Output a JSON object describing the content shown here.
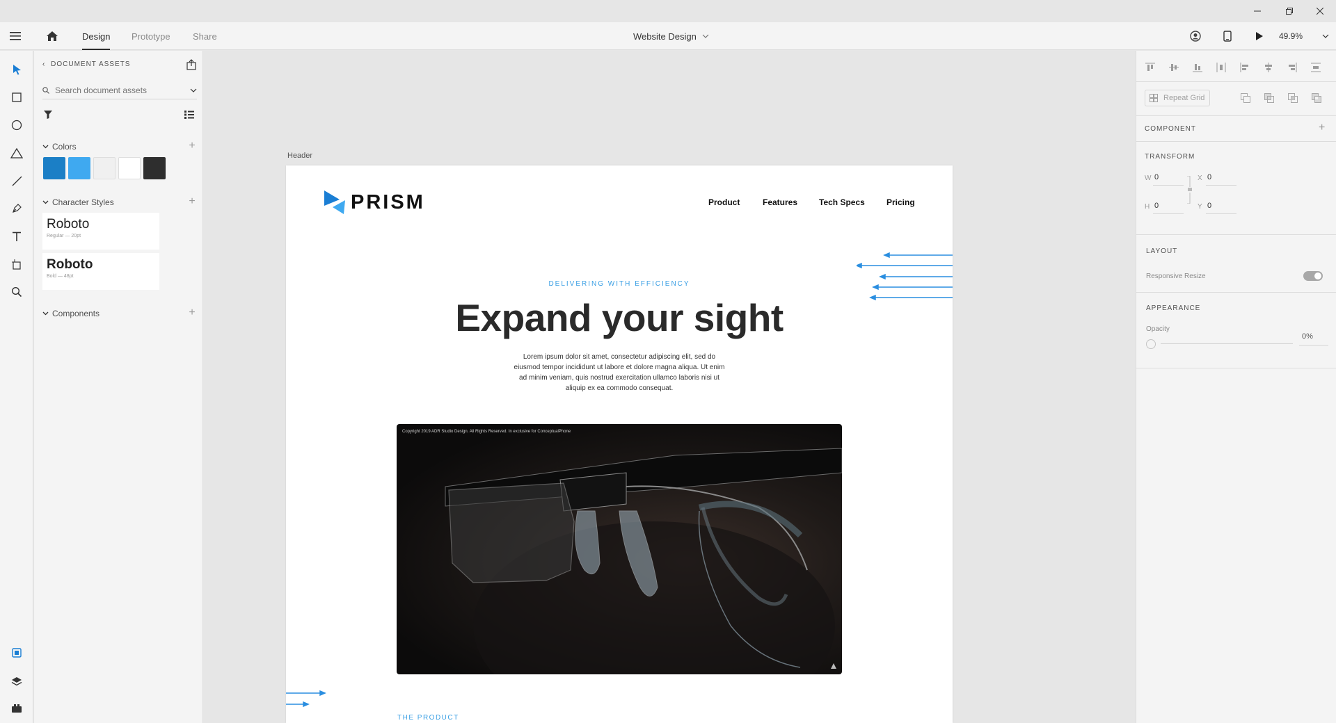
{
  "app": {
    "tabs": [
      {
        "label": "Design"
      },
      {
        "label": "Prototype"
      },
      {
        "label": "Share"
      }
    ],
    "doc_title": "Website Design",
    "zoom": "49.9%"
  },
  "assets": {
    "header": "DOCUMENT ASSETS",
    "search_placeholder": "Search document assets",
    "colors_label": "Colors",
    "colors": [
      "#1b7fc6",
      "#3fa9f0",
      "#f0f0f0",
      "#ffffff",
      "#2e2e2e"
    ],
    "character_styles_label": "Character Styles",
    "character_styles": [
      {
        "name": "Roboto",
        "meta": "Regular — 20pt"
      },
      {
        "name": "Roboto",
        "meta": "Bold — 48pt"
      }
    ],
    "components_label": "Components"
  },
  "canvas": {
    "artboard_label": "Header",
    "logo": "PRISM",
    "nav": [
      "Product",
      "Features",
      "Tech Specs",
      "Pricing"
    ],
    "eyebrow": "DELIVERING WITH EFFICIENCY",
    "hero_title": "Expand your sight",
    "hero_body": "Lorem ipsum dolor sit amet, consectetur adipiscing elit, sed do eiusmod tempor incididunt ut labore et dolore magna aliqua. Ut enim ad minim veniam, quis nostrud exercitation ullamco laboris nisi ut aliquip ex ea commodo consequat.",
    "image_copyright": "Copyright 2019 ADR Studio Design. All Rights Reserved. In exclusive for ConceptualPhone",
    "section_eyebrow": "THE PRODUCT",
    "accent_color": "#3a9fe4"
  },
  "props": {
    "repeat_grid": "Repeat Grid",
    "component": "COMPONENT",
    "transform": "TRANSFORM",
    "w_label": "W",
    "w_value": "0",
    "x_label": "X",
    "x_value": "0",
    "h_label": "H",
    "h_value": "0",
    "y_label": "Y",
    "y_value": "0",
    "layout": "LAYOUT",
    "responsive_resize": "Responsive Resize",
    "responsive_resize_on": true,
    "appearance": "APPEARANCE",
    "opacity_label": "Opacity",
    "opacity_value": "0%"
  }
}
